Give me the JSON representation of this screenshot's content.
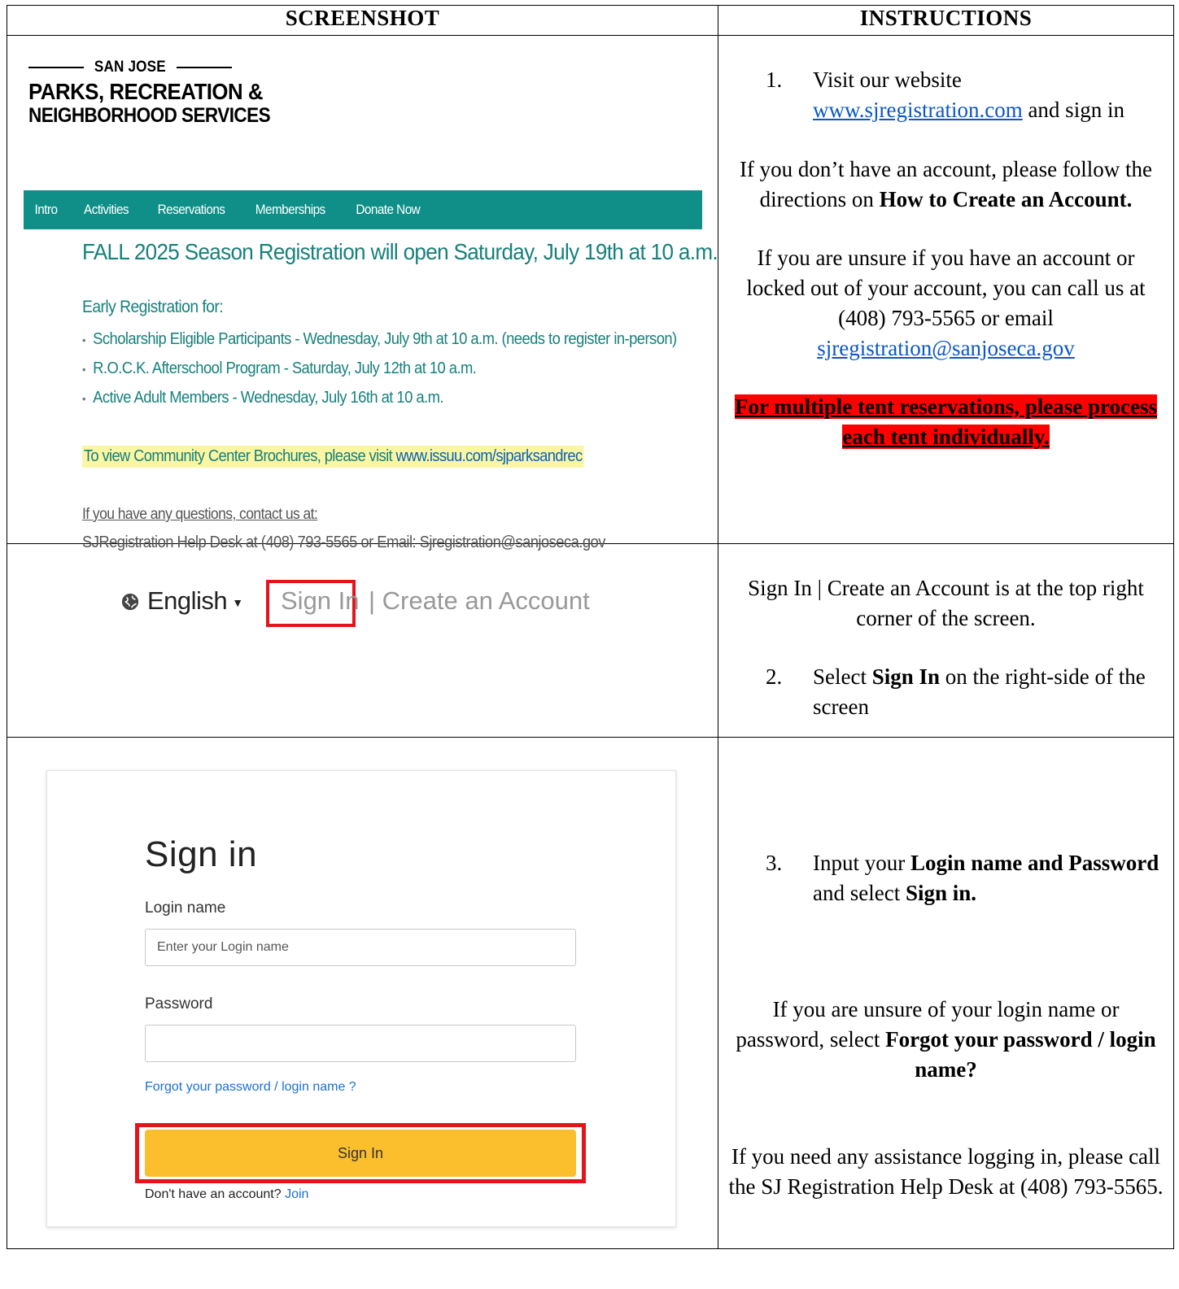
{
  "headers": {
    "screenshot": "SCREENSHOT",
    "instructions": "INSTRUCTIONS"
  },
  "row1": {
    "brand": {
      "top": "SAN JOSE",
      "line2": "PARKS, RECREATION &",
      "line3": "NEIGHBORHOOD SERVICES"
    },
    "nav": [
      "Intro",
      "Activities",
      "Reservations",
      "Memberships",
      "Donate Now"
    ],
    "season": "FALL 2025 Season Registration will open Saturday, July 19th at 10 a.m.",
    "early": "Early Registration for:",
    "bullets": [
      "Scholarship Eligible Participants - Wednesday, July 9th at 10 a.m. (needs to register in-person)",
      "R.O.C.K. Afterschool Program - Saturday, July 12th at 10 a.m.",
      "Active Adult Members - Wednesday, July 16th at 10 a.m."
    ],
    "brochure_text": "To view Community Center Brochures, please visit ",
    "brochure_link": "www.issuu.com/sjparksandrec",
    "questions": "If you have any questions, contact us at:",
    "helpdesk": "SJRegistration Help Desk at (408) 793-5565 or Email: Sjregistration@sanjoseca.gov",
    "instr": {
      "step_num": "1.",
      "step_pre": "Visit our website ",
      "step_link": "www.sjregistration.com",
      "step_post": " and sign in",
      "noacct_pre": "If you don’t have an account, please follow the directions on ",
      "noacct_bold": "How to Create an Account.",
      "unsure": "If you are unsure if you have an account or locked out of your account, you can call us at (408) 793-5565 or email",
      "email": "sjregistration@sanjoseca.gov",
      "warn": "For multiple tent reservations, please process each tent individually."
    }
  },
  "row2": {
    "lang": "English",
    "signin": "Sign In",
    "create": "| Create an Account",
    "instr": {
      "top": "Sign In | Create an Account is at the top right corner of the screen.",
      "step_num": "2.",
      "step_pre": "Select ",
      "step_bold": "Sign In",
      "step_post": " on the right-side of the screen"
    }
  },
  "row3": {
    "title": "Sign in",
    "login_label": "Login name",
    "login_placeholder": "Enter your Login name",
    "password_label": "Password",
    "forgot": "Forgot your password / login name ?",
    "button": "Sign In",
    "noacct": "Don't have an account? ",
    "join": "Join",
    "instr": {
      "step_num": "3.",
      "step_pre": "Input your ",
      "step_bold1": "Login name and Password",
      "step_mid": " and select ",
      "step_bold2": "Sign in.",
      "unsure_pre": "If you are unsure of your login name or password, select ",
      "unsure_bold": "Forgot your password / login name?",
      "assist": "If you need any assistance logging in, please call the SJ Registration Help Desk at (408) 793-5565."
    }
  },
  "colors": {
    "teal_nav": "#0f8f88",
    "teal_text": "#17807b",
    "highlight_red": "#e3141a",
    "button_yellow": "#fbbf2e"
  }
}
